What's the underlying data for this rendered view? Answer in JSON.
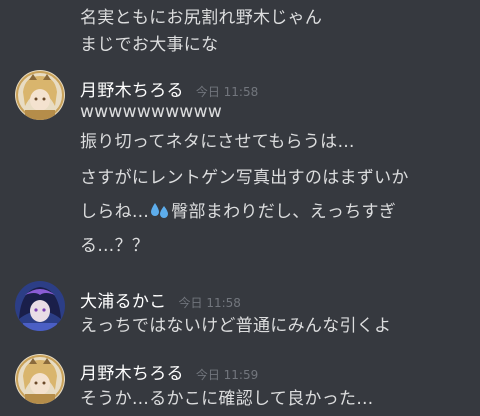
{
  "chat": {
    "continued_lines": [
      "名実ともにお尻割れ野木じゃん",
      "まじでお大事にな"
    ],
    "messages": [
      {
        "author": "月野木ちろる",
        "timestamp": "今日 11:58",
        "avatar": "chiroru-avatar",
        "lines": [
          "wwwwwwwwww",
          "振り切ってネタにさせてもらうは…",
          "さすがにレントゲン写真出すのはまずいか",
          {
            "before": "しらね…",
            "emoji": "sweat-droplets-emoji",
            "after": "臀部まわりだし、えっちすぎ"
          },
          "る…？？"
        ]
      },
      {
        "author": "大浦るかこ",
        "timestamp": "今日 11:58",
        "avatar": "rukako-avatar",
        "lines": [
          "えっちではないけど普通にみんな引くよ"
        ]
      },
      {
        "author": "月野木ちろる",
        "timestamp": "今日 11:59",
        "avatar": "chiroru-avatar",
        "lines": [
          "そうか…るかこに確認して良かった…"
        ]
      }
    ]
  },
  "colors": {
    "background": "#36393f",
    "message_text": "#dcddde",
    "username": "#ffffff",
    "timestamp": "#72767d",
    "emoji_drop": "#5dadec"
  }
}
